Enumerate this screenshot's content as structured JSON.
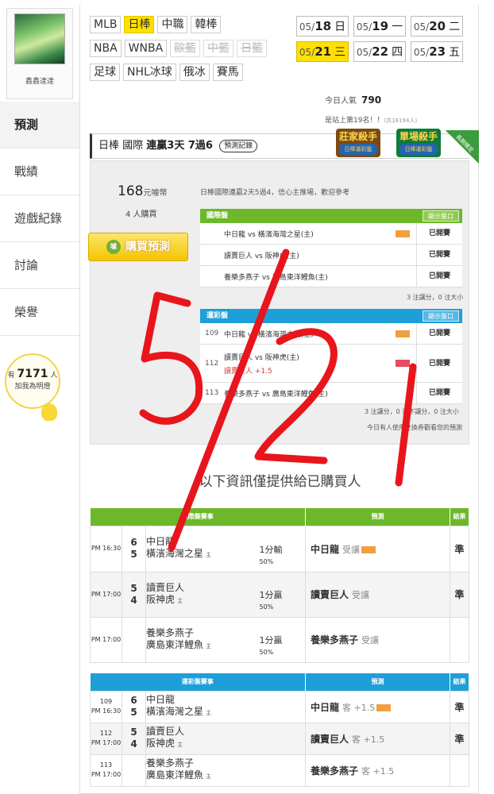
{
  "sidebar": {
    "user_name": "鑫鑫達達",
    "menu": [
      {
        "label": "預測",
        "active": true
      },
      {
        "label": "戰績",
        "active": false
      },
      {
        "label": "遊戲紀錄",
        "active": false
      },
      {
        "label": "討論",
        "active": false
      },
      {
        "label": "榮譽",
        "active": false
      }
    ],
    "fans_prefix": "有",
    "fans_count": "7171",
    "fans_suffix": "人",
    "fans_sub": "加我為明燈"
  },
  "leagues": {
    "row1": [
      {
        "label": "MLB",
        "state": "normal"
      },
      {
        "label": "日棒",
        "state": "active"
      },
      {
        "label": "中職",
        "state": "normal"
      },
      {
        "label": "韓棒",
        "state": "normal"
      }
    ],
    "row2": [
      {
        "label": "NBA",
        "state": "normal"
      },
      {
        "label": "WNBA",
        "state": "normal"
      },
      {
        "label": "歐籃",
        "state": "off"
      },
      {
        "label": "中籃",
        "state": "off"
      },
      {
        "label": "日籃",
        "state": "off"
      }
    ],
    "row3": [
      {
        "label": "足球",
        "state": "normal"
      },
      {
        "label": "NHL冰球",
        "state": "normal"
      },
      {
        "label": "俄冰",
        "state": "normal"
      },
      {
        "label": "賽馬",
        "state": "normal"
      }
    ]
  },
  "dates": [
    {
      "md": "05/",
      "d": "18",
      "w": "日",
      "active": false
    },
    {
      "md": "05/",
      "d": "19",
      "w": "一",
      "active": false
    },
    {
      "md": "05/",
      "d": "20",
      "w": "二",
      "active": false
    },
    {
      "md": "05/",
      "d": "21",
      "w": "三",
      "active": true
    },
    {
      "md": "05/",
      "d": "22",
      "w": "四",
      "active": false
    },
    {
      "md": "05/",
      "d": "23",
      "w": "五",
      "active": false
    }
  ],
  "stats": {
    "popular_label": "今日人氣",
    "popular_value": "790",
    "rank_text": "是站上第19名！！",
    "rank_small": "(共18194人)"
  },
  "title": {
    "league": "日棒 國際",
    "streak": "連贏3天 7過6",
    "record_btn": "預測記錄"
  },
  "badges": {
    "b1_title": "莊家殺手",
    "b1_sub": "日棒運彩盤",
    "b2_title": "單場殺手",
    "b2_sub": "日棒運彩盤",
    "corner": "長期穩定"
  },
  "panel": {
    "price": "168",
    "price_unit": "元噱幣",
    "buyers": "4 人購買",
    "buy_btn": "購買預測",
    "coin": "噱",
    "desc": "日棒國際連贏2天5過4，信心主推場，歡迎參考",
    "intl": {
      "head": "國際盤",
      "show": "顯示盤口",
      "rows": [
        {
          "no": "",
          "match": "中日龍 vs 橫濱海灣之星(主)",
          "tag": "orange",
          "res": "已開賽"
        },
        {
          "no": "",
          "match": "讀賣巨人 vs 阪神虎(主)",
          "tag": "",
          "res": "已開賽"
        },
        {
          "no": "",
          "match": "養樂多燕子 vs 廣島東洋鯉魚(主)",
          "tag": "",
          "res": "已開賽"
        }
      ],
      "note": "3 注讓分，0 注大小"
    },
    "sport": {
      "head": "運彩盤",
      "show": "顯示盤口",
      "rows": [
        {
          "no": "109",
          "match": "中日龍 vs 橫濱海灣之星(主)",
          "sub": "",
          "tag": "orange",
          "res": "已開賽"
        },
        {
          "no": "112",
          "match": "讀賣巨人 vs 阪神虎(主)",
          "sub": "讀賣巨人 +1.5",
          "tag": "red",
          "res": "已開賽"
        },
        {
          "no": "113",
          "match": "養樂多燕子 vs 廣島東洋鯉魚(主)",
          "sub": "",
          "tag": "",
          "res": "已開賽"
        }
      ],
      "note": "3 注讓分，0 注不讓分，0 注大小",
      "note2": "今日有人使用兌換券觀看您的預測"
    }
  },
  "info_msg": "以下資訊僅提供給已購買人",
  "intl_table": {
    "headers": [
      "國際盤賽事",
      "預測",
      "結果"
    ],
    "rows": [
      {
        "time": "PM 16:30",
        "s1": "6",
        "s2": "5",
        "t1": "中日龍",
        "t2": "橫濱海灣之星",
        "home": "主",
        "odds": "1分輸",
        "pct": "50%",
        "pred": "中日龍",
        "pred_sub": "受讓",
        "tag": true,
        "result": "準"
      },
      {
        "time": "PM 17:00",
        "s1": "5",
        "s2": "4",
        "t1": "讀賣巨人",
        "t2": "阪神虎",
        "home": "主",
        "odds": "1分贏",
        "pct": "50%",
        "pred": "讀賣巨人",
        "pred_sub": "受讓",
        "tag": false,
        "result": "準"
      },
      {
        "time": "PM 17:00",
        "s1": "",
        "s2": "",
        "t1": "養樂多燕子",
        "t2": "廣島東洋鯉魚",
        "home": "主",
        "odds": "1分贏",
        "pct": "50%",
        "pred": "養樂多燕子",
        "pred_sub": "受讓",
        "tag": false,
        "result": ""
      }
    ]
  },
  "sport_table": {
    "headers": [
      "運彩盤賽事",
      "預測",
      "結果"
    ],
    "rows": [
      {
        "no": "109",
        "time": "PM 16:30",
        "s1": "6",
        "s2": "5",
        "t1": "中日龍",
        "t2": "橫濱海灣之星",
        "home": "主",
        "pred": "中日龍",
        "pred_sub": "客 +1.5",
        "tag": true,
        "result": "準"
      },
      {
        "no": "112",
        "time": "PM 17:00",
        "s1": "5",
        "s2": "4",
        "t1": "讀賣巨人",
        "t2": "阪神虎",
        "home": "主",
        "pred": "讀賣巨人",
        "pred_sub": "客 +1.5",
        "tag": false,
        "result": "準"
      },
      {
        "no": "113",
        "time": "PM 17:00",
        "s1": "",
        "s2": "",
        "t1": "養樂多燕子",
        "t2": "廣島東洋鯉魚",
        "home": "主",
        "pred": "養樂多燕子",
        "pred_sub": "客 +1.5",
        "tag": false,
        "result": ""
      }
    ]
  },
  "colors": {
    "intl_green": "#6cb82a",
    "sport_blue": "#1e9fd9",
    "handwriting_red": "#e8161c",
    "active_yellow": "#ffe000"
  }
}
